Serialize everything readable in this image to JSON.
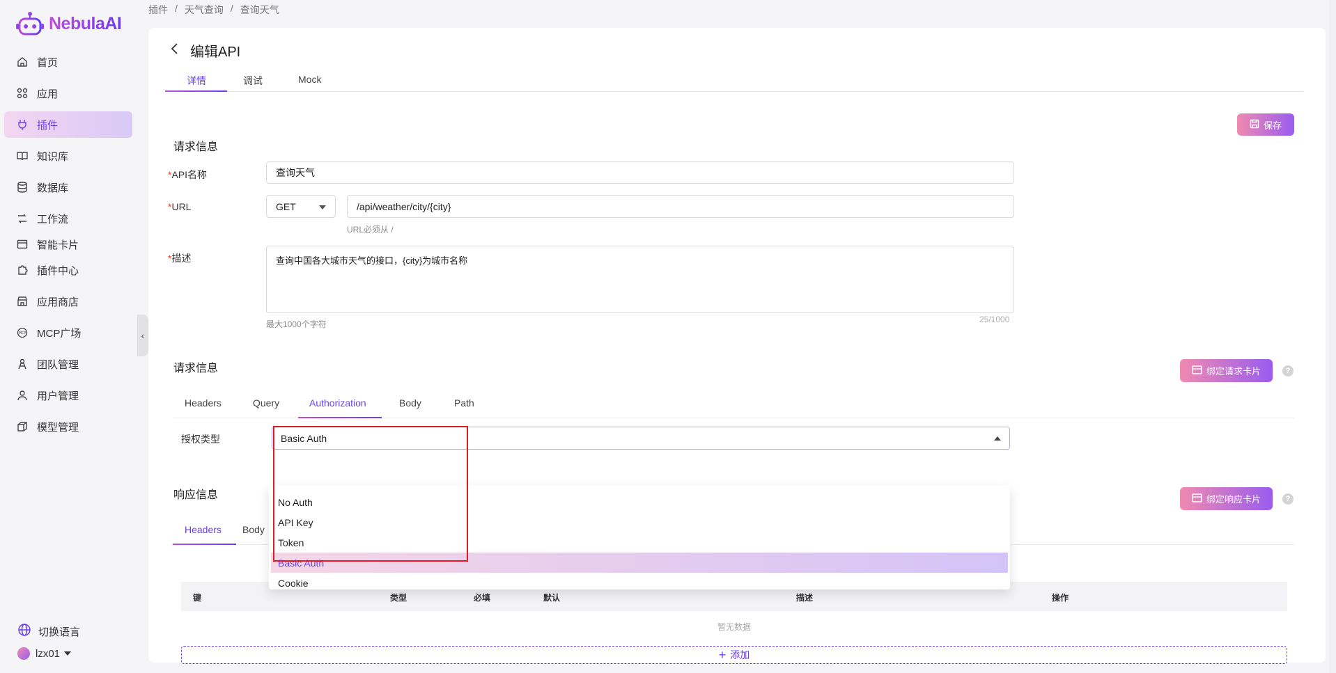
{
  "brand": {
    "name": "NebulaAI"
  },
  "sidebar": {
    "items": [
      {
        "label": "首页",
        "icon": "home-icon"
      },
      {
        "label": "应用",
        "icon": "apps-icon"
      },
      {
        "label": "插件",
        "icon": "plugin-icon",
        "active": true
      },
      {
        "label": "知识库",
        "icon": "book-icon"
      },
      {
        "label": "数据库",
        "icon": "database-icon"
      },
      {
        "label": "工作流",
        "icon": "workflow-icon"
      },
      {
        "label": "智能卡片",
        "icon": "card-icon"
      },
      {
        "label": "插件中心",
        "icon": "puzzle-icon"
      },
      {
        "label": "应用商店",
        "icon": "store-icon"
      },
      {
        "label": "MCP广场",
        "icon": "mcp-icon"
      },
      {
        "label": "团队管理",
        "icon": "team-icon"
      },
      {
        "label": "用户管理",
        "icon": "user-icon"
      },
      {
        "label": "模型管理",
        "icon": "model-icon"
      }
    ],
    "language_label": "切换语言",
    "username": "lzx01"
  },
  "breadcrumb": [
    "插件",
    "天气查询",
    "查询天气"
  ],
  "page": {
    "title": "编辑API",
    "tabs": [
      "详情",
      "调试",
      "Mock"
    ],
    "save_label": "保存"
  },
  "request_info": {
    "title": "请求信息",
    "api_name_label": "API名称",
    "api_name_value": "查询天气",
    "url_label": "URL",
    "method": "GET",
    "url_value": "/api/weather/city/{city}",
    "url_hint": "URL必须从 /",
    "desc_label": "描述",
    "desc_value": "查询中国各大城市天气的接口，{city}为城市名称",
    "desc_hint": "最大1000个字符",
    "desc_count": "25/1000"
  },
  "request_params": {
    "title": "请求信息",
    "bind_label": "绑定请求卡片",
    "tabs": [
      "Headers",
      "Query",
      "Authorization",
      "Body",
      "Path"
    ],
    "auth_label": "授权类型",
    "auth_value": "Basic Auth",
    "auth_options": [
      "No Auth",
      "API Key",
      "Token",
      "Basic Auth",
      "Cookie"
    ]
  },
  "response_info": {
    "title": "响应信息",
    "bind_label": "绑定响应卡片",
    "tabs": [
      "Headers",
      "Body"
    ],
    "columns": [
      "键",
      "类型",
      "必填",
      "默认",
      "描述",
      "操作"
    ],
    "empty_text": "暂无数据",
    "add_label": "添加"
  },
  "colors": {
    "accent": "#6a3ef0",
    "accent_pink": "#c04bd8",
    "required": "#e0442c",
    "highlight_box": "#e01b24"
  }
}
